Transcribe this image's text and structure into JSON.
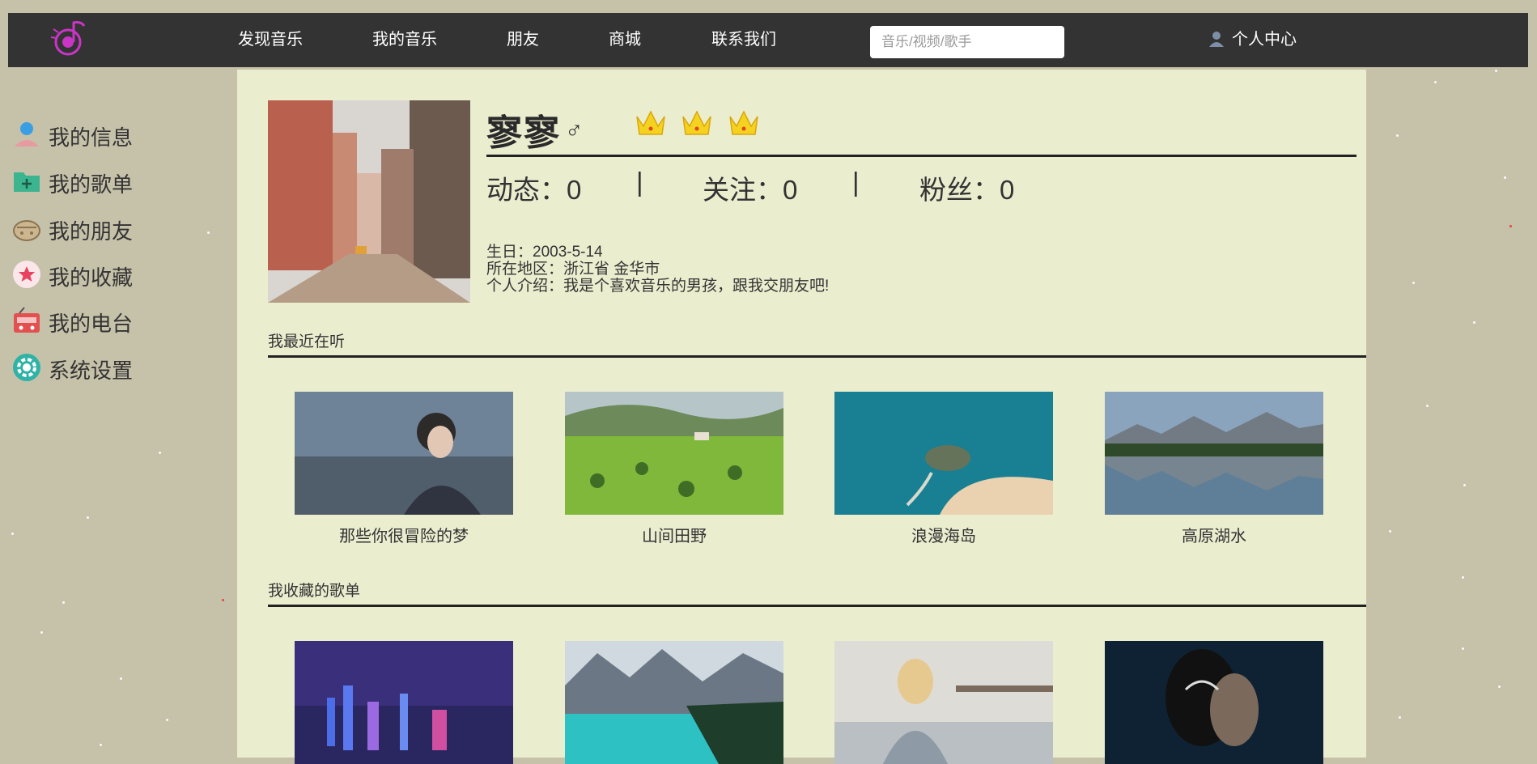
{
  "topbar": {
    "nav": [
      "发现音乐",
      "我的音乐",
      "朋友",
      "商城",
      "联系我们"
    ],
    "search_placeholder": "音乐/视频/歌手",
    "user_center": "个人中心"
  },
  "sidebar": {
    "items": [
      {
        "label": "我的信息",
        "icon": "user-info-icon"
      },
      {
        "label": "我的歌单",
        "icon": "playlist-folder-icon"
      },
      {
        "label": "我的朋友",
        "icon": "friends-icon"
      },
      {
        "label": "我的收藏",
        "icon": "favorite-star-icon"
      },
      {
        "label": "我的电台",
        "icon": "radio-icon"
      },
      {
        "label": "系统设置",
        "icon": "settings-gear-icon"
      }
    ]
  },
  "profile": {
    "name": "寥寥",
    "gender": "♂",
    "crown_count": 3,
    "stats": [
      {
        "label": "动态：",
        "value": "0"
      },
      {
        "label": "关注：",
        "value": "0"
      },
      {
        "label": "粉丝：",
        "value": "0"
      }
    ],
    "separator": "|",
    "birthday": "生日：2003-5-14",
    "location": "所在地区：浙江省 金华市",
    "intro": "个人介绍：我是个喜欢音乐的男孩，跟我交朋友吧!"
  },
  "recent": {
    "title": "我最近在听",
    "items": [
      "那些你很冒险的梦",
      "山间田野",
      "浪漫海岛",
      "高原湖水"
    ]
  },
  "collected": {
    "title": "我收藏的歌单",
    "items": [
      "city-night",
      "mountain-lake",
      "girl-with-camera",
      "venom"
    ]
  },
  "colors": {
    "page_bg": "#c6c1a9",
    "topbar_bg": "#333333",
    "panel_bg": "#ebedcf",
    "logo_accent": "#c935c6",
    "crown": "#f5d21f"
  }
}
